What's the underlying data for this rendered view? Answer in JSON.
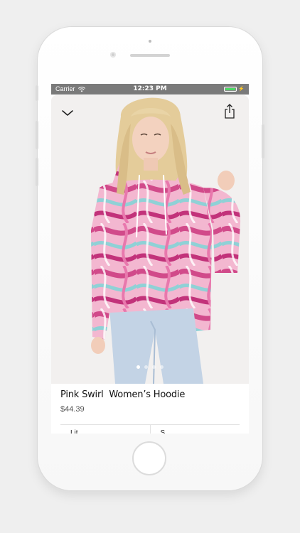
{
  "status_bar": {
    "carrier": "Carrier",
    "time": "12:23 PM",
    "battery_color": "#4cd964"
  },
  "icons": {
    "close": "chevron-down-icon",
    "share": "share-icon",
    "wifi": "wifi-icon"
  },
  "gallery": {
    "page_count": 4,
    "active_index": 0
  },
  "product": {
    "title": "Pink Swirl  Women’s Hoodie",
    "price": "$44.39"
  },
  "options": [
    {
      "label": "Lit"
    },
    {
      "label": "S"
    }
  ],
  "colors": {
    "swirl_pink": "#d14a8a",
    "swirl_light_pink": "#f3b7d0",
    "swirl_aqua": "#8fd1d6",
    "denim": "#c3d3e5"
  }
}
